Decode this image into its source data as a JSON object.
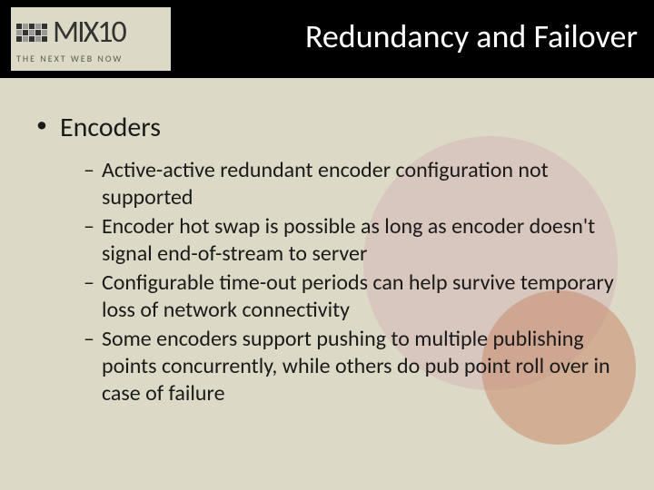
{
  "logo": {
    "main": "MIX10",
    "sub": "THE NEXT WEB NOW"
  },
  "title": "Redundancy and Failover",
  "bullets": {
    "l1": "Encoders",
    "l2": [
      "Active-active redundant encoder configuration not supported",
      "Encoder hot swap is possible as long as encoder doesn't signal end-of-stream to server",
      "Configurable time-out periods can help survive temporary loss of network connectivity",
      "Some encoders support pushing to multiple publishing points concurrently, while others do pub point roll over in case of failure"
    ]
  }
}
